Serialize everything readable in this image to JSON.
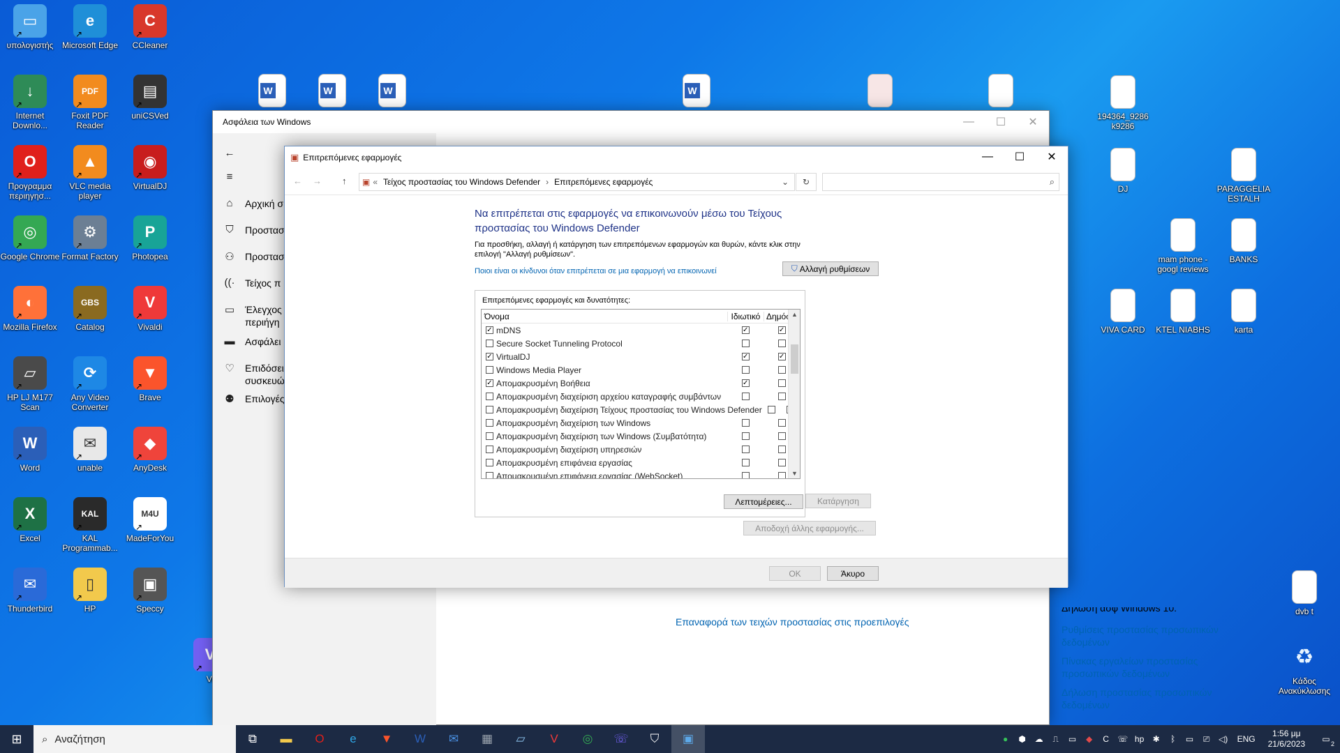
{
  "desktop": {
    "icons_left": [
      {
        "label": "υπολογιστής",
        "color": "#4aa3e8",
        "glyph": "▭"
      },
      {
        "label": "Microsoft Edge",
        "color": "#1f8fd8",
        "glyph": "e"
      },
      {
        "label": "CCleaner",
        "color": "#d8382b",
        "glyph": "C"
      },
      {
        "label": "Internet Downlo...",
        "color": "#2e8b57",
        "glyph": "↓"
      },
      {
        "label": "Foxit PDF Reader",
        "color": "#f28b1e",
        "glyph": "PDF"
      },
      {
        "label": "uniCSVed",
        "color": "#333333",
        "glyph": "▤"
      },
      {
        "label": "Προγραμμα περιηγησ...",
        "color": "#e0201b",
        "glyph": "O"
      },
      {
        "label": "VLC media player",
        "color": "#f28b1e",
        "glyph": "▲"
      },
      {
        "label": "VirtualDJ",
        "color": "#c81d1d",
        "glyph": "◉"
      },
      {
        "label": "Google Chrome",
        "color": "#34a853",
        "glyph": "◎"
      },
      {
        "label": "Format Factory",
        "color": "#6c7f94",
        "glyph": "⚙"
      },
      {
        "label": "Photopea",
        "color": "#18a497",
        "glyph": "P"
      },
      {
        "label": "Mozilla Firefox",
        "color": "#ff7139",
        "glyph": "◐"
      },
      {
        "label": "Catalog",
        "color": "#8a6a20",
        "glyph": "GBS"
      },
      {
        "label": "Vivaldi",
        "color": "#ef3939",
        "glyph": "V"
      },
      {
        "label": "HP LJ M177 Scan",
        "color": "#4a4a4a",
        "glyph": "▱"
      },
      {
        "label": "Any Video Converter",
        "color": "#1e88e5",
        "glyph": "⟳"
      },
      {
        "label": "Brave",
        "color": "#fb542b",
        "glyph": "▼"
      },
      {
        "label": "Word",
        "color": "#2b5fb8",
        "glyph": "W"
      },
      {
        "label": "unable",
        "color": "#e8e8e8",
        "glyph": "✉"
      },
      {
        "label": "AnyDesk",
        "color": "#ef443b",
        "glyph": "◆"
      },
      {
        "label": "Excel",
        "color": "#1e7145",
        "glyph": "X"
      },
      {
        "label": "KAL Programmab...",
        "color": "#2a2a2a",
        "glyph": "KAL"
      },
      {
        "label": "MadeForYou",
        "color": "#ffffff",
        "glyph": "M4U"
      },
      {
        "label": "Thunderbird",
        "color": "#2a6ad8",
        "glyph": "✉"
      },
      {
        "label": "HP",
        "color": "#f2c94c",
        "glyph": "▯"
      },
      {
        "label": "Speccy",
        "color": "#555555",
        "glyph": "▣"
      },
      {
        "label": "Vi",
        "color": "#7360f2",
        "glyph": "V"
      }
    ],
    "icons_right": [
      {
        "label": "194364_9286 k9286"
      },
      {
        "label": "DJ"
      },
      {
        "label": "PARAGGELIA ESTALH"
      },
      {
        "label": "mam phone - googl reviews"
      },
      {
        "label": "BANKS"
      },
      {
        "label": "VIVA CARD"
      },
      {
        "label": "KTEL NIABHS"
      },
      {
        "label": "karta"
      },
      {
        "label": "dvb t"
      },
      {
        "label": "Κάδος Ανακύκλωσης"
      }
    ]
  },
  "security_window": {
    "title": "Ασφάλεια των Windows",
    "nav": [
      {
        "icon": "home-icon",
        "glyph": "⌂",
        "label": "Αρχική σ"
      },
      {
        "icon": "shield-icon",
        "glyph": "⛉",
        "label": "Προστασ"
      },
      {
        "icon": "person-icon",
        "glyph": "⚇",
        "label": "Προστασ"
      },
      {
        "icon": "wifi-icon",
        "glyph": "((·",
        "label": "Τείχος π"
      },
      {
        "icon": "app-browser-icon",
        "glyph": "▭",
        "label": "Έλεγχος περιήγη"
      },
      {
        "icon": "laptop-icon",
        "glyph": "▬",
        "label": "Ασφάλει"
      },
      {
        "icon": "heart-icon",
        "glyph": "♡",
        "label": "Επιδόσει συσκευώ"
      },
      {
        "icon": "family-icon",
        "glyph": "⚉",
        "label": "Επιλογές"
      }
    ],
    "restore_link": "Επαναφορά των τειχών προστασίας στις προεπιλογές",
    "partial_heading": "Δηλωση ασφ Windows 10.",
    "privacy_links": [
      "Ρυθμίσεις προστασίας προσωπικών δεδομένων",
      "Πίνακας εργαλείων προστασίας προσωπικών δεδομένων",
      "Δήλωση προστασίας προσωπικών δεδομένων"
    ]
  },
  "dialog": {
    "title": "Επιτρεπόμενες εφαρμογές",
    "breadcrumb_prefix": "«",
    "breadcrumb": [
      "Τείχος προστασίας του Windows Defender",
      "Επιτρεπόμενες εφαρμογές"
    ],
    "search_placeholder": "",
    "heading": "Να επιτρέπεται στις εφαρμογές να επικοινωνούν μέσω του Τείχους προστασίας του Windows Defender",
    "description": "Για προσθήκη, αλλαγή ή κατάργηση των επιτρεπόμενων εφαρμογών και θυρών, κάντε κλικ στην επιλογή \"Αλλαγή ρυθμίσεων\".",
    "risk_link": "Ποιοι είναι οι κίνδυνοι όταν επιτρέπεται σε μια εφαρμογή να επικοινωνεί",
    "change_settings": "Αλλαγή ρυθμίσεων",
    "group_label": "Επιτρεπόμενες εφαρμογές και δυνατότητες:",
    "columns": {
      "name": "Όνομα",
      "private": "Ιδιωτικό",
      "public": "Δημόσιο"
    },
    "apps": [
      {
        "name": "mDNS",
        "enabled": true,
        "private": true,
        "public": true
      },
      {
        "name": "Secure Socket Tunneling Protocol",
        "enabled": false,
        "private": false,
        "public": false
      },
      {
        "name": "VirtualDJ",
        "enabled": true,
        "private": true,
        "public": true
      },
      {
        "name": "Windows Media Player",
        "enabled": false,
        "private": false,
        "public": false
      },
      {
        "name": "Απομακρυσμένη Βοήθεια",
        "enabled": true,
        "private": true,
        "public": false
      },
      {
        "name": "Απομακρυσμένη διαχείριση αρχείου καταγραφής συμβάντων",
        "enabled": false,
        "private": false,
        "public": false
      },
      {
        "name": "Απομακρυσμένη διαχείριση Τείχους προστασίας του Windows Defender",
        "enabled": false,
        "private": false,
        "public": false
      },
      {
        "name": "Απομακρυσμένη διαχείριση των Windows",
        "enabled": false,
        "private": false,
        "public": false
      },
      {
        "name": "Απομακρυσμένη διαχείριση των Windows (Συμβατότητα)",
        "enabled": false,
        "private": false,
        "public": false
      },
      {
        "name": "Απομακρυσμένη διαχείριση υπηρεσιών",
        "enabled": false,
        "private": false,
        "public": false
      },
      {
        "name": "Απομακρυσμένη επιφάνεια εργασίας",
        "enabled": false,
        "private": false,
        "public": false
      },
      {
        "name": "Απομακρυσμένη επιφάνεια εργασίας (WebSocket)",
        "enabled": false,
        "private": false,
        "public": false
      }
    ],
    "details_button": "Λεπτομέρειες...",
    "remove_button": "Κατάργηση",
    "allow_other_button": "Αποδοχή άλλης εφαρμογής...",
    "ok_button": "OK",
    "cancel_button": "Άκυρο"
  },
  "taskbar": {
    "search_text": "Αναζήτηση",
    "apps": [
      {
        "name": "task-view-icon",
        "glyph": "⧉",
        "color": "#ffffff"
      },
      {
        "name": "file-explorer-icon",
        "glyph": "▬",
        "color": "#f2c94c"
      },
      {
        "name": "opera-icon",
        "glyph": "O",
        "color": "#e0201b"
      },
      {
        "name": "edge-icon",
        "glyph": "e",
        "color": "#2fa6e6"
      },
      {
        "name": "brave-icon",
        "glyph": "▼",
        "color": "#fb542b"
      },
      {
        "name": "word-icon",
        "glyph": "W",
        "color": "#2b5fb8"
      },
      {
        "name": "mail-icon",
        "glyph": "✉",
        "color": "#4a90e2"
      },
      {
        "name": "calculator-icon",
        "glyph": "▦",
        "color": "#9aa3ad"
      },
      {
        "name": "notepad-icon",
        "glyph": "▱",
        "color": "#8ec5f0"
      },
      {
        "name": "vivaldi-icon",
        "glyph": "V",
        "color": "#ef3939"
      },
      {
        "name": "chrome-icon",
        "glyph": "◎",
        "color": "#34a853"
      },
      {
        "name": "viber-icon",
        "glyph": "☏",
        "color": "#7360f2"
      },
      {
        "name": "security-icon",
        "glyph": "⛉",
        "color": "#ffffff"
      },
      {
        "name": "firewall-app-icon",
        "glyph": "▣",
        "color": "#5da9e9"
      }
    ],
    "language": "ENG",
    "time": "1:56 μμ",
    "date": "21/6/2023",
    "notification_count": "2"
  }
}
